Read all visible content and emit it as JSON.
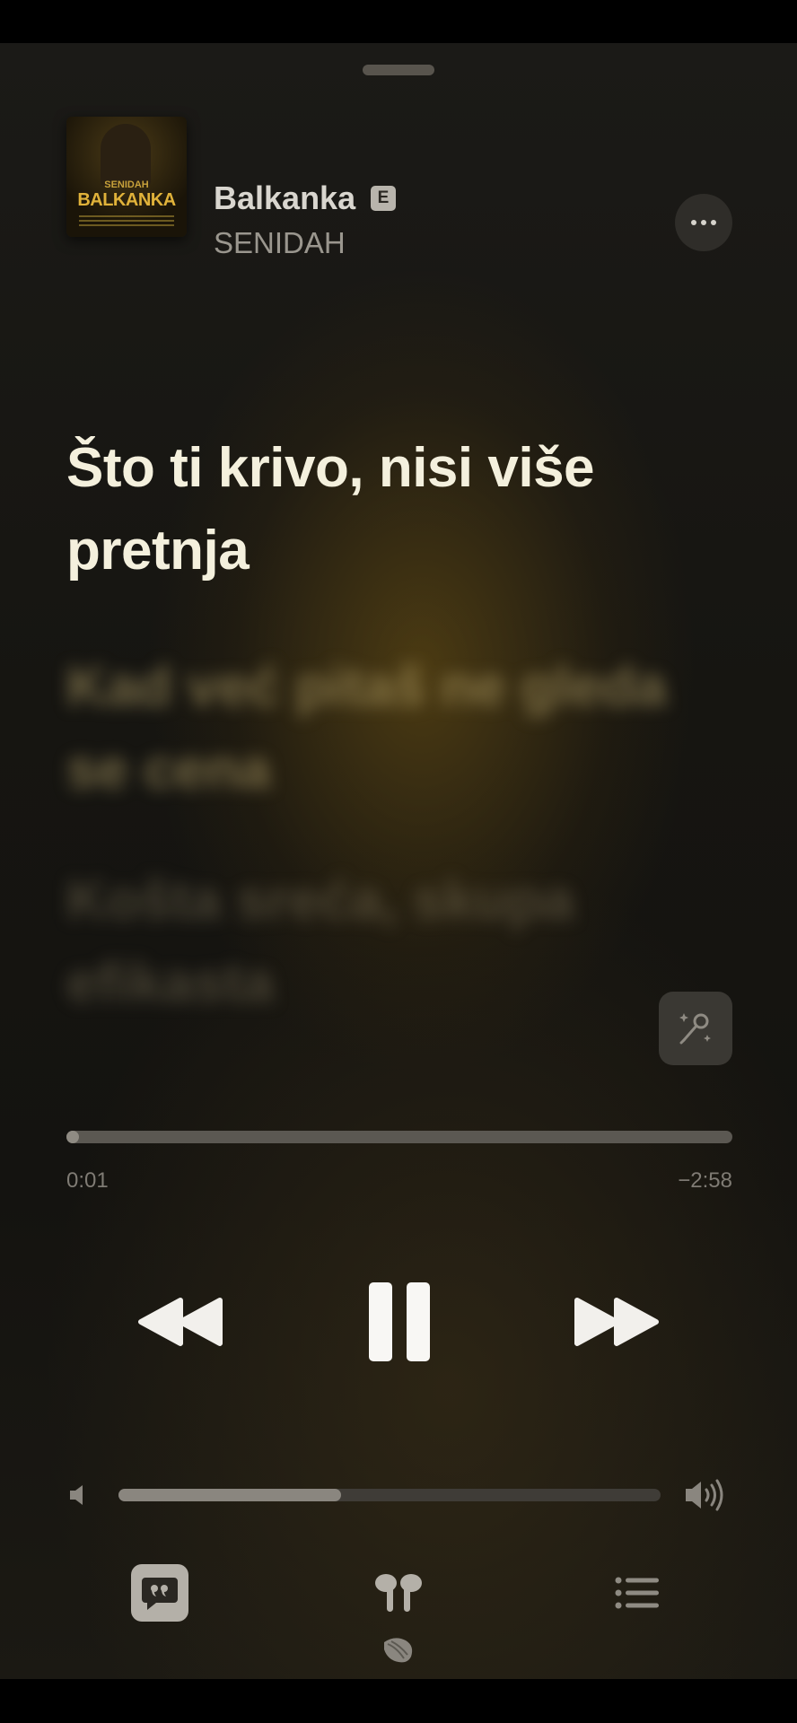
{
  "now_playing": {
    "song_title": "Balkanka",
    "explicit_badge": "E",
    "artist": "SENIDAH",
    "album_art": {
      "small_text": "SENIDAH",
      "title": "BALKANKA"
    }
  },
  "lyrics": {
    "current": "Što ti krivo, nisi više pretnja",
    "next": "Kad već pitaš ne gleda se cena",
    "upcoming": "Košta sreća, skupa efikasta"
  },
  "playback": {
    "elapsed": "0:01",
    "remaining": "−2:58",
    "progress_fraction": 0.005,
    "state": "playing"
  },
  "volume": {
    "level_fraction": 0.41
  },
  "icons": {
    "more": "ellipsis-icon",
    "karaoke": "sing-microphone-icon",
    "rewind": "rewind-icon",
    "pause": "pause-icon",
    "forward": "fast-forward-icon",
    "volume_low": "speaker-low-icon",
    "volume_high": "speaker-high-icon",
    "lyrics": "lyrics-quote-icon",
    "airplay": "airpods-icon",
    "queue": "list-icon"
  },
  "colors": {
    "lyric_active": "#f4f0dd",
    "accent_gold": "#e0b23a"
  }
}
